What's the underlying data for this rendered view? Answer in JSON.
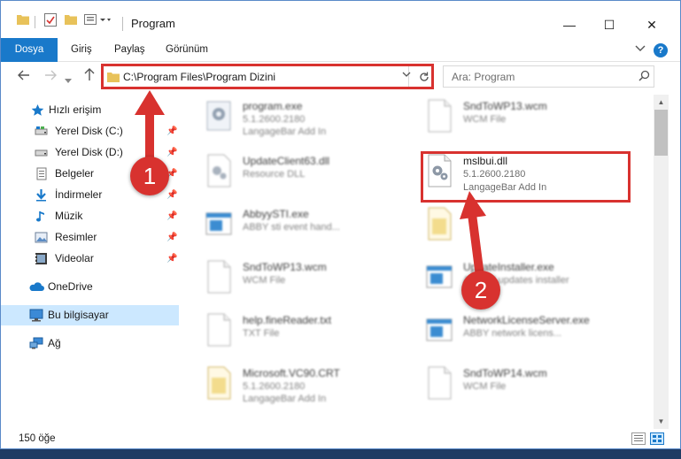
{
  "window": {
    "title": "Program",
    "controls": {
      "minimize": "—",
      "maximize": "☐",
      "close": "✕"
    }
  },
  "ribbon": {
    "tabs": [
      "Dosya",
      "Giriş",
      "Paylaş",
      "Görünüm"
    ],
    "help": "?"
  },
  "address": {
    "path": "C:\\Program Files\\Program Dizini",
    "search_placeholder": "Ara: Program"
  },
  "sidebar": {
    "quick_access": "Hızlı erişim",
    "items": [
      {
        "label": "Yerel Disk (C:)",
        "icon": "drive-icon",
        "pinned": true
      },
      {
        "label": "Yerel Disk (D:)",
        "icon": "drive-icon",
        "pinned": true
      },
      {
        "label": "Belgeler",
        "icon": "documents-icon",
        "pinned": true
      },
      {
        "label": "İndirmeler",
        "icon": "download-icon",
        "pinned": true
      },
      {
        "label": "Müzik",
        "icon": "music-icon",
        "pinned": true
      },
      {
        "label": "Resimler",
        "icon": "pictures-icon",
        "pinned": true
      },
      {
        "label": "Videolar",
        "icon": "video-icon",
        "pinned": true
      }
    ],
    "onedrive": "OneDrive",
    "this_pc": "Bu bilgisayar",
    "network": "Ağ"
  },
  "files": [
    {
      "name": "program.exe",
      "line1": "5.1.2600.2180",
      "line2": "LangageBar Add In",
      "icon": "exe-icon"
    },
    {
      "name": "SndToWP13.wcm",
      "line1": "WCM File",
      "line2": "",
      "icon": "blank-file-icon"
    },
    {
      "name": "UpdateClient63.dll",
      "line1": "Resource DLL",
      "line2": "",
      "icon": "dll-icon"
    },
    {
      "name": "mslbui.dll",
      "line1": "5.1.2600.2180",
      "line2": "LangageBar Add In",
      "icon": "dll-icon"
    },
    {
      "name": "AbbyySTI.exe",
      "line1": "ABBY sti event hand...",
      "line2": "",
      "icon": "window-exe-icon"
    },
    {
      "name": "",
      "line1": "",
      "line2": "",
      "icon": "folder-file-icon"
    },
    {
      "name": "SndToWP13.wcm",
      "line1": "WCM File",
      "line2": "",
      "icon": "blank-file-icon"
    },
    {
      "name": "UpdateInstaller.exe",
      "line1": "ABBYY updates installer",
      "line2": "",
      "icon": "window-exe-icon"
    },
    {
      "name": "help.fineReader.txt",
      "line1": "TXT File",
      "line2": "",
      "icon": "blank-file-icon"
    },
    {
      "name": "NetworkLicenseServer.exe",
      "line1": "ABBY network licens...",
      "line2": "",
      "icon": "window-exe-icon"
    },
    {
      "name": "Microsoft.VC90.CRT",
      "line1": "5.1.2600.2180",
      "line2": "LangageBar Add In",
      "icon": "folder-file-icon"
    },
    {
      "name": "SndToWP14.wcm",
      "line1": "WCM File",
      "line2": "",
      "icon": "blank-file-icon"
    }
  ],
  "status": {
    "count": "150 öğe"
  },
  "annotations": {
    "step1": "1",
    "step2": "2"
  },
  "colors": {
    "accent": "#1979ca",
    "highlight": "#d8322f",
    "selected": "#cce8ff"
  }
}
